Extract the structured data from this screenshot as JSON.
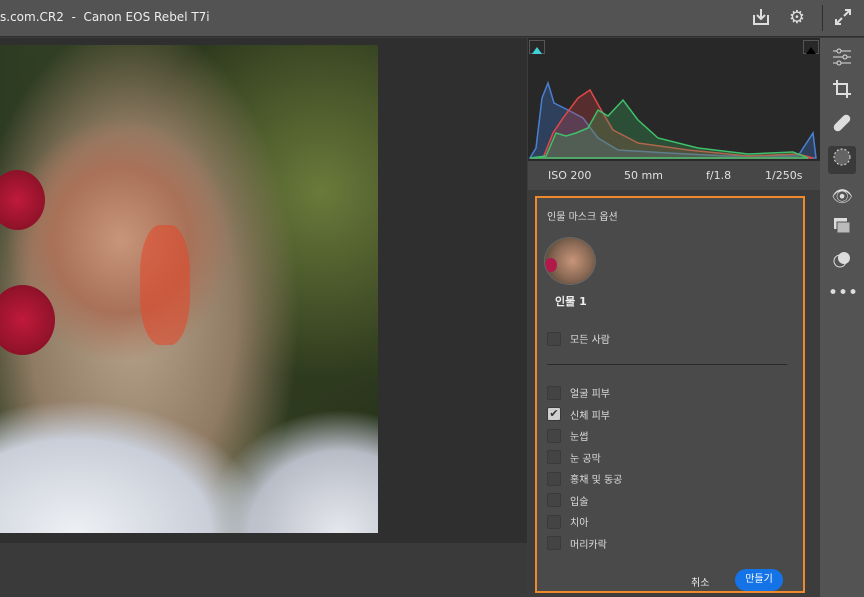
{
  "header": {
    "title": "s.com.CR2  -  Canon EOS Rebel T7i"
  },
  "toolbar_icons": [
    "download-icon",
    "gear-icon",
    "expand-icon"
  ],
  "histogram": {
    "highlight_clip_color": "#3fd0d8",
    "shadow_clip_color": "#000000"
  },
  "exif": {
    "iso": "ISO 200",
    "focal": "50 mm",
    "aperture": "f/1.8",
    "shutter": "1/250s"
  },
  "mask_panel": {
    "title": "인물 마스크 옵션",
    "person_label": "인물 1",
    "all_people": {
      "label": "모든 사람",
      "checked": false
    },
    "options": [
      {
        "label": "얼굴 피부",
        "checked": false
      },
      {
        "label": "신체 피부",
        "checked": true
      },
      {
        "label": "눈썹",
        "checked": false
      },
      {
        "label": "눈 공막",
        "checked": false
      },
      {
        "label": "홍채 및 동공",
        "checked": false
      },
      {
        "label": "입술",
        "checked": false
      },
      {
        "label": "치아",
        "checked": false
      },
      {
        "label": "머리카락",
        "checked": false
      }
    ],
    "cancel": "취소",
    "create": "만들기",
    "accent": "#1473e6",
    "highlight_border": "#ef8a2c"
  },
  "side_tools": [
    "sliders-icon",
    "crop-icon",
    "healing-icon",
    "masking-icon",
    "red-eye-icon",
    "snapshots-icon",
    "presets-icon",
    "more-icon"
  ]
}
